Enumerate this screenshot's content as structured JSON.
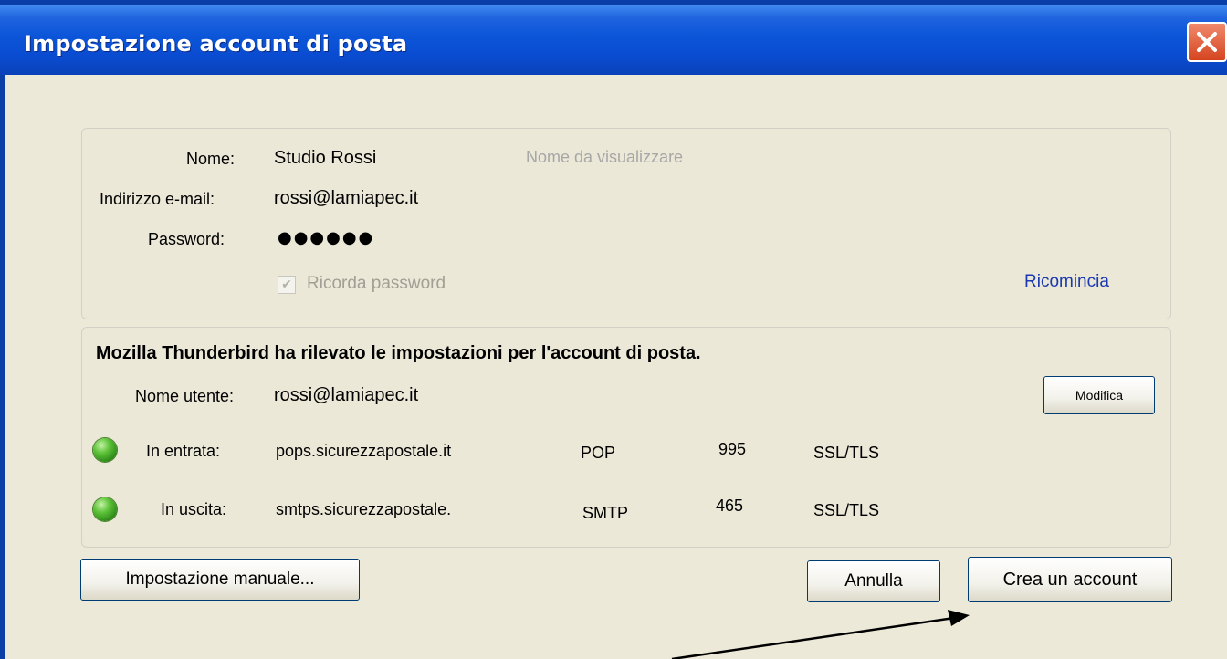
{
  "window": {
    "title": "Impostazione account di posta",
    "close_glyph": "✕"
  },
  "account": {
    "name_label": "Nome:",
    "name_value": "Studio Rossi",
    "name_hint": "Nome da visualizzare",
    "email_label": "Indirizzo e-mail:",
    "email_value": "rossi@lamiapec.it",
    "password_label": "Password:",
    "password_mask": "●●●●●●",
    "remember_label": "Ricorda password",
    "remember_checked": true,
    "restart_link": "Ricomincia"
  },
  "detected": {
    "heading": "Mozilla Thunderbird ha rilevato le impostazioni per l'account di posta.",
    "username_label": "Nome utente:",
    "username_value": "rossi@lamiapec.it",
    "edit_button": "Modifica",
    "servers": [
      {
        "label": "In entrata:",
        "host": "pops.sicurezzapostale.it",
        "protocol": "POP",
        "port": "995",
        "security": "SSL/TLS",
        "status_color": "#3aa61e"
      },
      {
        "label": "In uscita:",
        "host": "smtps.sicurezzapostale.",
        "protocol": "SMTP",
        "port": "465",
        "security": "SSL/TLS",
        "status_color": "#3aa61e"
      }
    ]
  },
  "buttons": {
    "manual_setup": "Impostazione manuale...",
    "cancel": "Annulla",
    "create_account": "Crea un account"
  }
}
